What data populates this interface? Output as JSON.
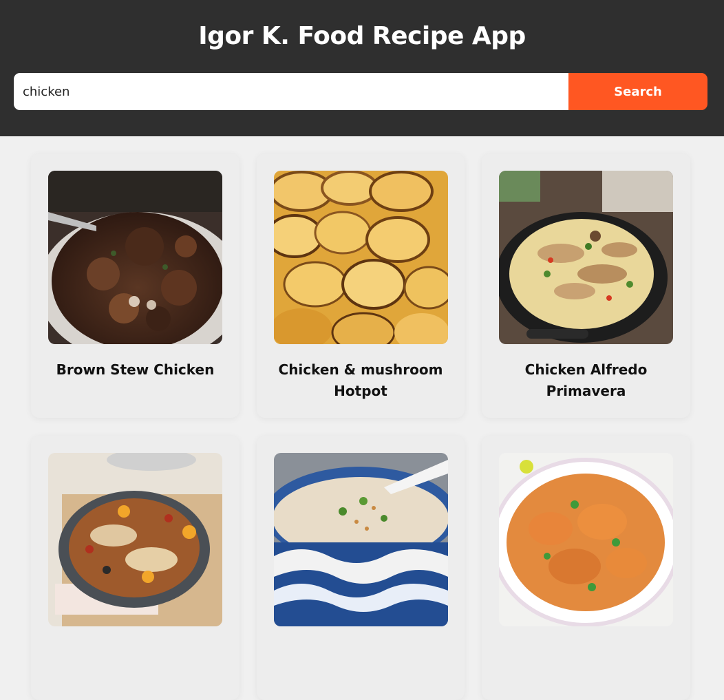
{
  "header": {
    "title": "Igor K. Food Recipe App"
  },
  "search": {
    "value": "chicken",
    "button_label": "Search"
  },
  "colors": {
    "header_bg": "#2f2f2f",
    "accent": "#ff5722",
    "page_bg": "#f0f0f0"
  },
  "recipes": [
    {
      "name": "Brown Stew Chicken",
      "image": "brown-stew-chicken-photo"
    },
    {
      "name": "Chicken & mushroom Hotpot",
      "image": "chicken-mushroom-hotpot-photo"
    },
    {
      "name": "Chicken Alfredo Primavera",
      "image": "chicken-alfredo-primavera-photo"
    },
    {
      "name": "",
      "image": "chicken-casserole-photo"
    },
    {
      "name": "",
      "image": "chicken-congee-photo"
    },
    {
      "name": "",
      "image": "chicken-curry-photo"
    }
  ]
}
